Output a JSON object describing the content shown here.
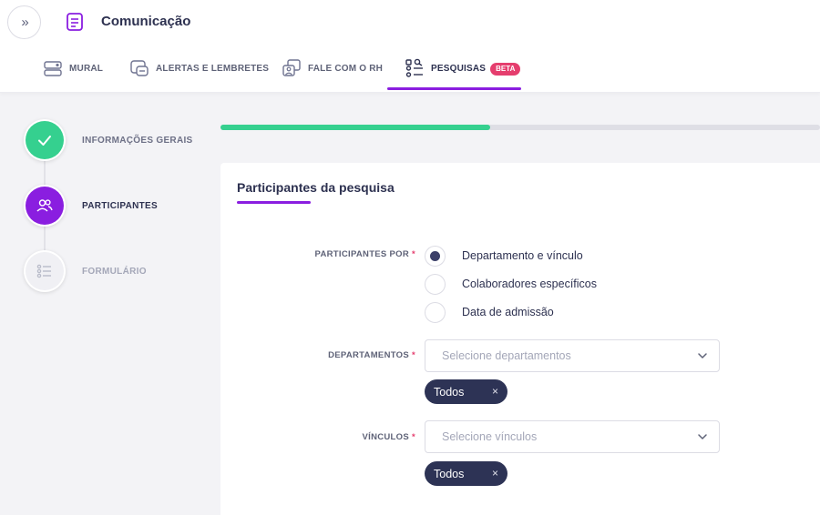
{
  "header": {
    "title": "Comunicação",
    "expand_glyph": "»"
  },
  "tabs": [
    {
      "label": "MURAL",
      "icon": "mural-icon"
    },
    {
      "label": "ALERTAS E LEMBRETES",
      "icon": "alerts-icon"
    },
    {
      "label": "FALE COM O RH",
      "icon": "chat-hr-icon"
    },
    {
      "label": "PESQUISAS",
      "icon": "survey-icon",
      "badge": "BETA",
      "active": true
    }
  ],
  "steps": [
    {
      "label": "INFORMAÇÕES GERAIS",
      "state": "done"
    },
    {
      "label": "PARTICIPANTES",
      "state": "current"
    },
    {
      "label": "FORMULÁRIO",
      "state": "pending"
    }
  ],
  "progress": 0.45,
  "card": {
    "title": "Participantes da pesquisa",
    "participants_by": {
      "label": "PARTICIPANTES POR",
      "required": "*",
      "options": [
        "Departamento e vínculo",
        "Colaboradores específicos",
        "Data de admissão"
      ],
      "selected": 0
    },
    "departments": {
      "label": "DEPARTAMENTOS",
      "required": "*",
      "placeholder": "Selecione departamentos",
      "chips": [
        "Todos"
      ]
    },
    "bonds": {
      "label": "VÍNCULOS",
      "required": "*",
      "placeholder": "Selecione vínculos",
      "chips": [
        "Todos"
      ]
    },
    "chip_remove": "×"
  },
  "colors": {
    "accent": "#8a1ee0",
    "success": "#35d08f",
    "badge": "#e53e6e",
    "chip": "#2d3355"
  }
}
